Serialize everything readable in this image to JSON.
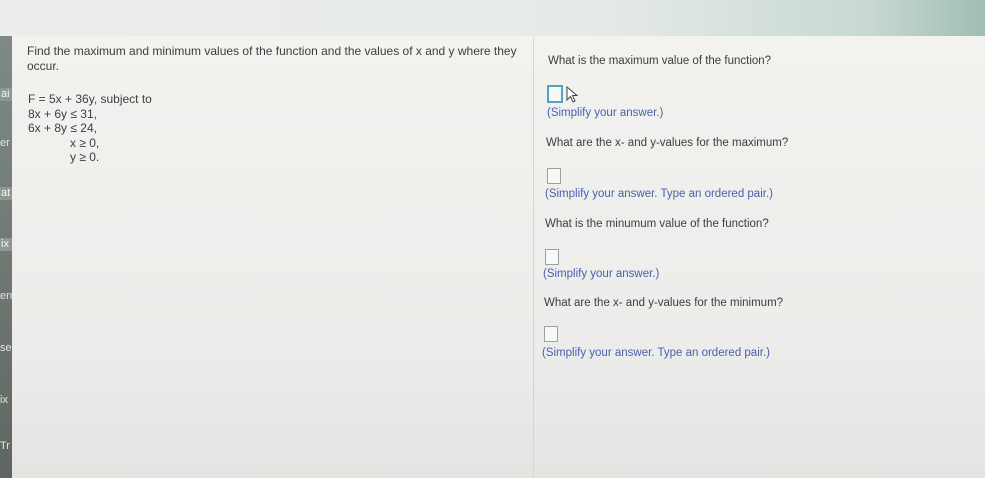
{
  "left_strip": {
    "items": [
      "ai",
      "er",
      "at",
      "ix",
      "erm",
      "se",
      "ix",
      "Tr"
    ]
  },
  "question": {
    "text": "Find the maximum and minimum values of the function and the values of x and y where they occur.",
    "function_line": "F = 5x + 36y, subject to",
    "constraints": [
      "8x + 6y ≤ 31,",
      "6x + 8y ≤ 24,",
      "x ≥ 0,",
      "y ≥ 0."
    ]
  },
  "answers": {
    "max_value": {
      "prompt": "What is the maximum value of the function?",
      "hint": "(Simplify your answer.)"
    },
    "max_xy": {
      "prompt": "What are the x- and y-values for the maximum?",
      "hint": "(Simplify your answer. Type an ordered pair.)"
    },
    "min_value": {
      "prompt": "What is the minumum value of the function?",
      "hint": "(Simplify your answer.)"
    },
    "min_xy": {
      "prompt": "What are the x- and y-values for the minimum?",
      "hint": "(Simplify your answer. Type an ordered pair.)"
    }
  },
  "colors": {
    "hint_text": "#4a5fae",
    "focus_border": "#4fa4c4"
  }
}
